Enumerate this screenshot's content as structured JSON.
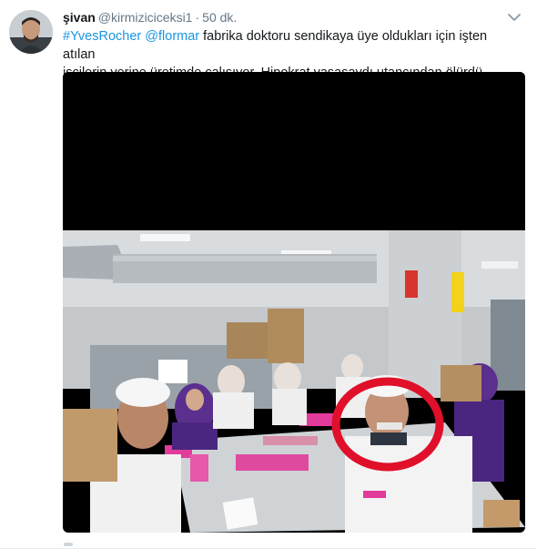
{
  "tweet": {
    "display_name": "şivan",
    "handle": "@kirmiziciceksi1",
    "separator": "·",
    "time": "50 dk.",
    "mention1": "#YvesRocher",
    "mention2": "@flormar",
    "text_line1_rest": " fabrika doktoru sendikaya üye oldukları için işten atılan",
    "text_line2": "işçilerin yerine üretimde çalışıyor. Hipokrat yaşasaydı utancından ölürdü."
  },
  "icons": {
    "caret": "chevron-down-icon",
    "avatar": "avatar"
  },
  "colors": {
    "link": "#1b95e0",
    "text": "#14171a",
    "muted": "#657786",
    "highlight_circle": "#e0102a"
  }
}
